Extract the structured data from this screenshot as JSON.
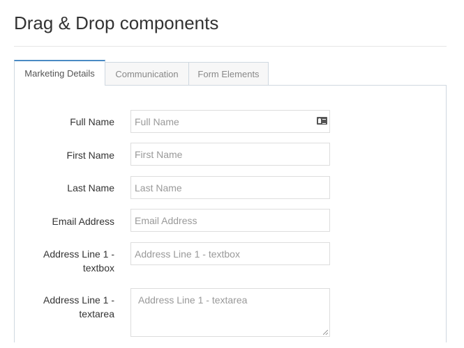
{
  "page": {
    "title": "Drag & Drop components"
  },
  "tabs": [
    {
      "label": "Marketing Details",
      "active": true
    },
    {
      "label": "Communication",
      "active": false
    },
    {
      "label": "Form Elements",
      "active": false
    }
  ],
  "form": {
    "full_name": {
      "label": "Full Name",
      "placeholder": "Full Name",
      "icon": "contact-card-icon"
    },
    "first_name": {
      "label": "First Name",
      "placeholder": "First Name"
    },
    "last_name": {
      "label": "Last Name",
      "placeholder": "Last Name"
    },
    "email": {
      "label": "Email Address",
      "placeholder": "Email Address"
    },
    "address_textbox": {
      "label": "Address Line 1 - textbox",
      "placeholder": "Address Line 1 - textbox"
    },
    "address_textarea": {
      "label": "Address Line 1 - textarea",
      "placeholder": "Address Line 1 - textarea"
    }
  },
  "colors": {
    "active_tab_accent": "#4a8ac4",
    "border": "#cfd8e0"
  }
}
